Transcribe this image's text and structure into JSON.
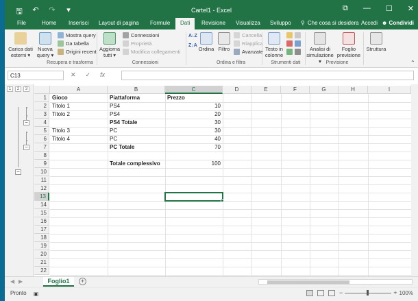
{
  "app": {
    "title": "Cartel1 - Excel",
    "accent": "#217346"
  },
  "qat": {
    "save_icon": "save-icon",
    "undo_icon": "undo-icon",
    "redo_icon": "redo-icon",
    "customize_icon": "customize-qat-icon"
  },
  "window_buttons": {
    "ribbon_options": "⧉",
    "minimize": "—",
    "maximize": "☐",
    "close": "✕"
  },
  "tabs": [
    {
      "label": "File"
    },
    {
      "label": "Home"
    },
    {
      "label": "Inserisci"
    },
    {
      "label": "Layout di pagina"
    },
    {
      "label": "Formule"
    },
    {
      "label": "Dati",
      "active": true
    },
    {
      "label": "Revisione"
    },
    {
      "label": "Visualizza"
    },
    {
      "label": "Sviluppo"
    }
  ],
  "tell_me": "Che cosa si desidera",
  "account": "Accedi",
  "share": "Condividi",
  "ribbon": {
    "carica_dati": "Carica dati esterni ▾",
    "nuova_query": "Nuova query ▾",
    "mostra_query": "Mostra query",
    "da_tabella": "Da tabella",
    "origini_recenti": "Origini recenti",
    "aggiorna_tutti": "Aggiorna tutti ▾",
    "connessioni": "Connessioni",
    "proprieta": "Proprietà",
    "modifica_collegamenti": "Modifica collegamenti",
    "ordina": "Ordina",
    "filtro": "Filtro",
    "cancella": "Cancella",
    "riapplica": "Riapplica",
    "avanzate": "Avanzate",
    "testo_in_colonne": "Testo in colonne",
    "analisi_simulazione": "Analisi di simulazione ▾",
    "foglio_previsione": "Foglio previsione",
    "struttura": "Struttura",
    "groups": {
      "recupera": "Recupera e trasforma",
      "connessioni": "Connessioni",
      "ordina": "Ordina e filtra",
      "strumenti": "Strumenti dati",
      "previsione": "Previsione"
    }
  },
  "formula_bar": {
    "name_box": "C13",
    "cancel": "✕",
    "enter": "✓",
    "fx": "fx",
    "value": ""
  },
  "outline": {
    "levels": [
      "1",
      "2",
      "3"
    ]
  },
  "columns": [
    "A",
    "B",
    "C",
    "D",
    "E",
    "F",
    "G",
    "H",
    "I"
  ],
  "rows": [
    "1",
    "2",
    "3",
    "4",
    "5",
    "6",
    "7",
    "8",
    "9",
    "10",
    "11",
    "12",
    "13",
    "14",
    "15",
    "16",
    "17",
    "18",
    "19",
    "20",
    "21",
    "22"
  ],
  "cells": {
    "A1": "Gioco",
    "B1": "Piattaforma",
    "C1": "Prezzo",
    "A2": "Titolo 1",
    "B2": "PS4",
    "C2": "10",
    "A3": "Titolo 2",
    "B3": "PS4",
    "C3": "20",
    "B4": "PS4 Totale",
    "C4": "30",
    "A5": "Titolo 3",
    "B5": "PC",
    "C5": "30",
    "A6": "Titolo 4",
    "B6": "PC",
    "C6": "40",
    "B7": "PC Totale",
    "C7": "70",
    "B9": "Totale complessivo",
    "C9": "100"
  },
  "selected_cell": "C13",
  "sheet_tab": "Foglio1",
  "status": {
    "text": "Pronto",
    "zoom": "100%",
    "zoom_out": "−",
    "zoom_in": "+"
  }
}
